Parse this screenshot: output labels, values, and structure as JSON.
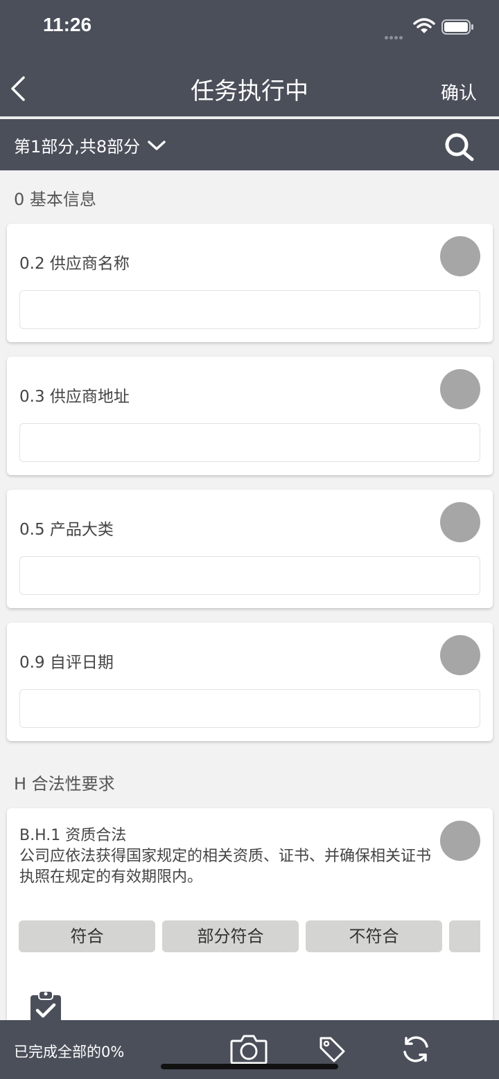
{
  "status_bar": {
    "time": "11:26"
  },
  "nav": {
    "title": "任务执行中",
    "confirm_label": "确认"
  },
  "section_picker": {
    "label": "第1部分,共8部分"
  },
  "groups": [
    {
      "header": "0 基本信息",
      "fields": [
        {
          "label": "0.2 供应商名称",
          "value": ""
        },
        {
          "label": "0.3 供应商地址",
          "value": ""
        },
        {
          "label": "0.5 产品大类",
          "value": ""
        },
        {
          "label": "0.9 自评日期",
          "value": ""
        }
      ]
    },
    {
      "header": "H 合法性要求",
      "question": {
        "title": "B.H.1 资质合法",
        "description": "公司应依法获得国家规定的相关资质、证书、并确保相关证书执照在规定的有效期限内。",
        "options": [
          "符合",
          "部分符合",
          "不符合",
          ""
        ]
      }
    }
  ],
  "footer": {
    "progress_text": "已完成全部的0%",
    "progress_percent": 0
  },
  "colors": {
    "bar": "#4b4f5a",
    "status_dot": "#a6a6a6",
    "option_bg": "#d4d5d3"
  }
}
